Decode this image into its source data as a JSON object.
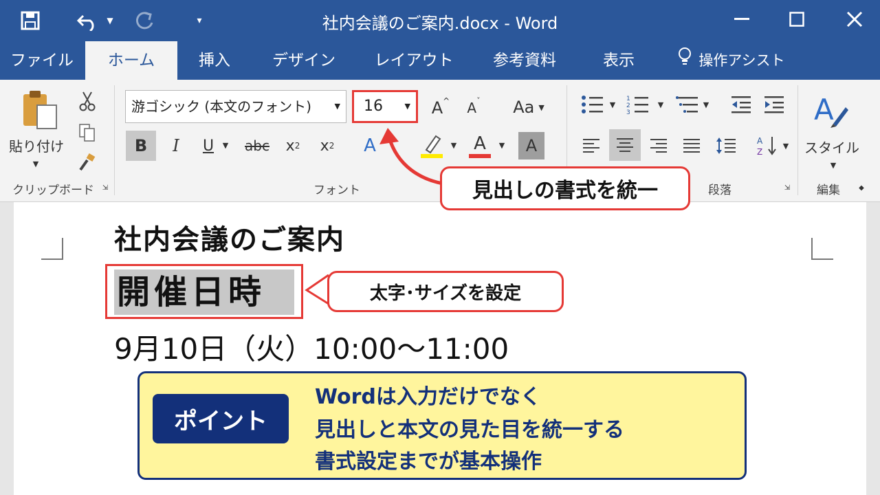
{
  "titlebar": {
    "title": "社内会議のご案内.docx  -  Word"
  },
  "tabs": [
    {
      "label": "ファイル"
    },
    {
      "label": "ホーム"
    },
    {
      "label": "挿入"
    },
    {
      "label": "デザイン"
    },
    {
      "label": "レイアウト"
    },
    {
      "label": "参考資料"
    },
    {
      "label": "表示"
    },
    {
      "label": "操作アシスト"
    }
  ],
  "ribbon": {
    "clipboard": {
      "paste_label": "貼り付け",
      "group_label": "クリップボード"
    },
    "font": {
      "font_name": "游ゴシック (本文のフォント)",
      "font_size": "16",
      "grow": "A",
      "shrink": "A",
      "case": "Aa",
      "bold": "B",
      "italic": "I",
      "underline": "U",
      "strike": "abc",
      "subscript": "x",
      "subscript_mark": "2",
      "superscript": "x",
      "superscript_mark": "2",
      "text_effect": "A",
      "font_color": "A",
      "shading": "A",
      "group_label": "フォント"
    },
    "paragraph": {
      "group_label": "段落"
    },
    "styles": {
      "label": "スタイル"
    },
    "editing": {
      "group_label": "編集"
    }
  },
  "document": {
    "heading1": "社内会議のご案内",
    "heading2": "開催日時",
    "date_line": "9月10日（火）10:00～11:00"
  },
  "callouts": {
    "format_unify": "見出しの書式を統一",
    "bold_size": "太字･サイズを設定"
  },
  "point": {
    "label": "ポイント",
    "lines": [
      "Wordは入力だけでなく",
      "見出しと本文の見た目を統一する",
      "書式設定までが基本操作"
    ]
  },
  "colors": {
    "word_blue": "#2b579a",
    "highlight_red": "#e53935",
    "point_navy": "#13307a",
    "point_yellow": "#fff59d",
    "highlight_yellow": "#ffeb00"
  }
}
